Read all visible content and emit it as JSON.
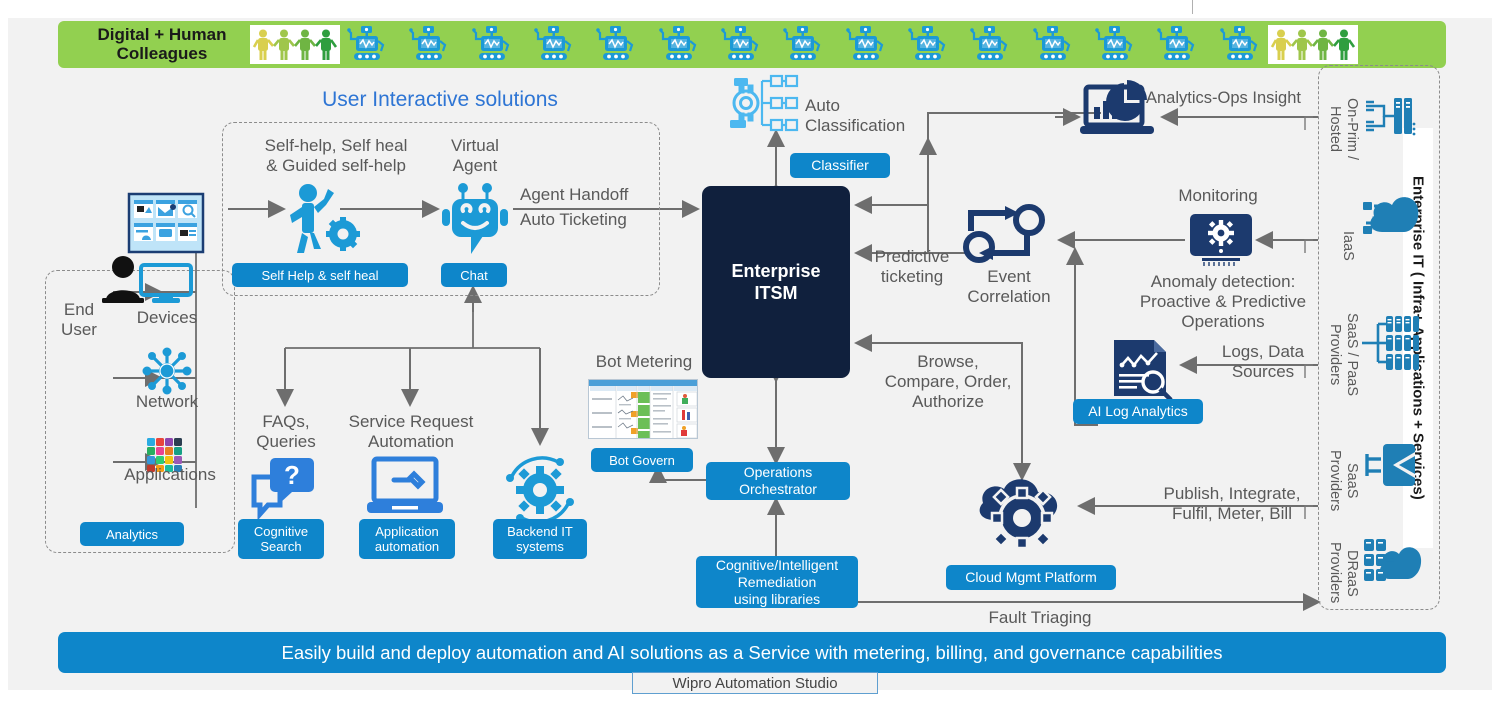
{
  "banner": {
    "title": "Digital + Human\nColleagues",
    "color": "#92d050",
    "robot_count": 15,
    "human_icon": "people-holding-hands-icon",
    "robot_icon": "robot-icon"
  },
  "left_group": {
    "end_user_label": "End\nUser",
    "end_user_icon": "person-at-laptop-icon",
    "dashboard_icon": "app-tiles-panel-icon",
    "items": [
      {
        "label": "Devices",
        "icon": "monitor-icon"
      },
      {
        "label": "Network",
        "icon": "network-hub-icon"
      },
      {
        "label": "Applications",
        "icon": "app-grid-icon"
      }
    ],
    "pill": "Analytics"
  },
  "user_interactive": {
    "section_title": "User Interactive solutions",
    "self_help": {
      "label": "Self-help, Self heal\n&  Guided self-help",
      "icon": "technician-gear-icon",
      "pill": "Self Help & self heal"
    },
    "virtual_agent": {
      "label": "Virtual\nAgent",
      "icon": "chatbot-icon",
      "pill": "Chat"
    },
    "handoff_labels": [
      "Agent Handoff",
      "Auto Ticketing"
    ]
  },
  "automation_row": [
    {
      "label": "FAQs,\nQueries",
      "icon": "question-chat-icon",
      "pill": "Cognitive\nSearch"
    },
    {
      "label": "Service Request\nAutomation",
      "icon": "laptop-wrench-icon",
      "pill": "Application\nautomation"
    },
    {
      "label": "",
      "icon": "gear-cycle-icon",
      "pill": "Backend IT\nsystems"
    }
  ],
  "bot_metering": {
    "label": "Bot Metering",
    "thumbnail_icon": "bot-metering-report-thumbnail",
    "pill": "Bot Govern"
  },
  "core": {
    "itsm_title": "Enterprise\nITSM",
    "itsm_color": "#10203d"
  },
  "auto_classification": {
    "label": "Auto\nClassification",
    "icon": "auto-classification-icon",
    "pill": "Classifier"
  },
  "analytics_ops": {
    "label": "Analytics-Ops Insight",
    "icon": "analytics-laptop-pie-icon"
  },
  "monitoring": {
    "label": "Monitoring",
    "icon": "monitor-gear-icon",
    "sub_label": "Anomaly detection:\nProactive & Predictive\nOperations"
  },
  "event_correlation": {
    "label": "Event\nCorrelation",
    "icon": "correlation-loop-icon"
  },
  "ai_log_analytics": {
    "icon": "log-magnifier-icon",
    "pill": "AI Log Analytics",
    "source_label": "Logs, Data\nSources"
  },
  "orchestration": {
    "operations_orchestrator": "Operations\nOrchestrator",
    "remediation": "Cognitive/Intelligent\nRemediation\nusing libraries"
  },
  "cloud": {
    "icon": "cloud-gear-icon",
    "pill": "Cloud Mgmt Platform",
    "publish_label": "Publish, Integrate,\nFulfil, Meter, Bill"
  },
  "flow_labels": {
    "predictive_ticketing": "Predictive\nticketing",
    "browse_compare": "Browse,\nCompare, Order,\nAuthorize",
    "fault_triaging": "Fault Triaging"
  },
  "enterprise_it": {
    "title": "Enterprise IT ( Infra+ Applications + Services)",
    "rows": [
      {
        "label": "On-Prim /\nHosted",
        "icon": "server-rack-icon"
      },
      {
        "label": "IaaS",
        "icon": "cloud-infra-icon"
      },
      {
        "label": "SaaS / PaaS\nProviders",
        "icon": "database-stack-icon"
      },
      {
        "label": "SaaS\nProviders",
        "icon": "saas-service-icon"
      },
      {
        "label": "DRaaS\nProviders",
        "icon": "dr-cloud-icon"
      }
    ]
  },
  "footer": {
    "banner": "Easily build and deploy automation and AI solutions as a Service with metering, billing, and  governance capabilities",
    "chip": "Wipro Automation Studio"
  },
  "colors": {
    "accent_blue": "#0e86ca",
    "dark_navy": "#10203d",
    "banner_green": "#92d050",
    "arrow_gray": "#6e6e6e",
    "text_gray": "#595959",
    "title_blue": "#2e75d4"
  }
}
